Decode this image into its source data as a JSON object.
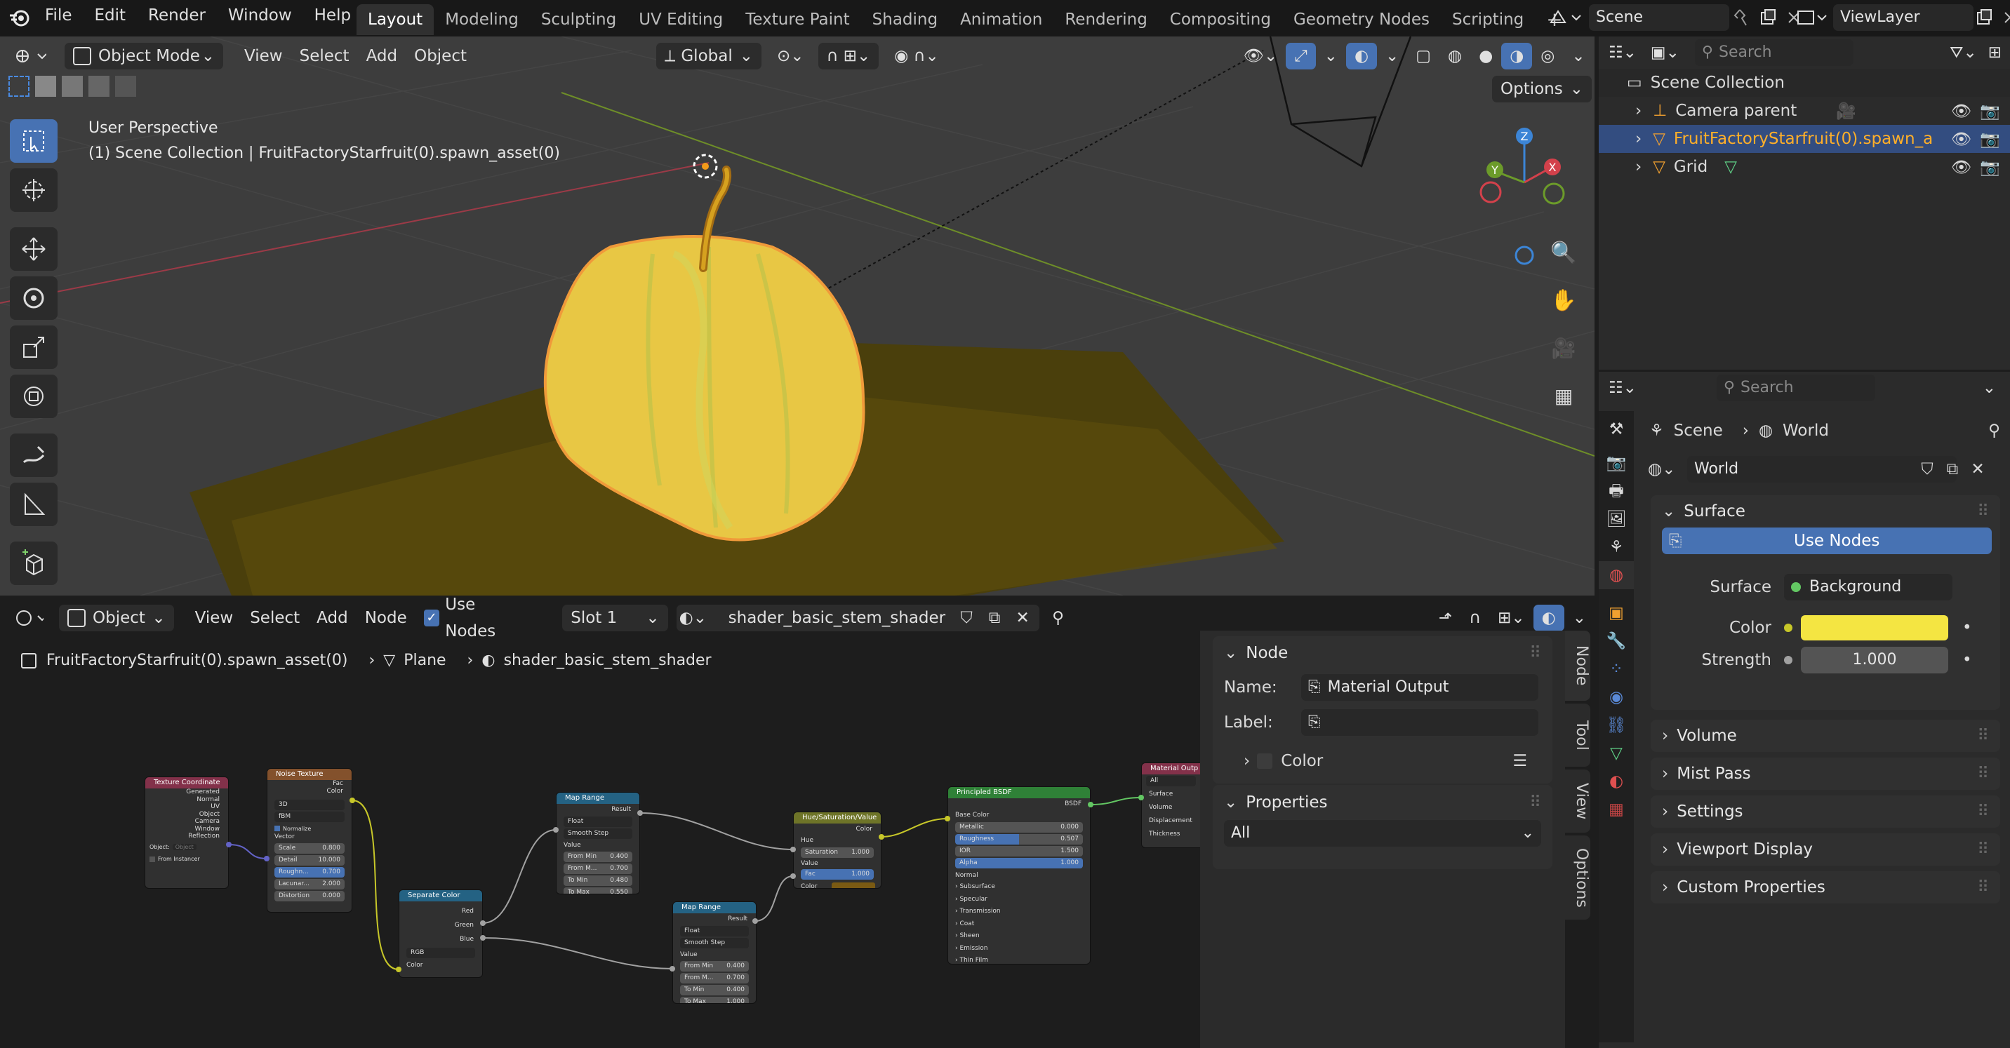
{
  "topbar": {
    "menus": [
      "File",
      "Edit",
      "Render",
      "Window",
      "Help"
    ],
    "workspaces": [
      "Layout",
      "Modeling",
      "Sculpting",
      "UV Editing",
      "Texture Paint",
      "Shading",
      "Animation",
      "Rendering",
      "Compositing",
      "Geometry Nodes",
      "Scripting"
    ],
    "active_workspace": "Layout",
    "scene": "Scene",
    "view_layer": "ViewLayer"
  },
  "viewport": {
    "mode": "Object Mode",
    "menus": [
      "View",
      "Select",
      "Add",
      "Object"
    ],
    "transform_orientation": "Global",
    "options_label": "Options",
    "overlay_title": "User Perspective",
    "overlay_subtitle": "(1) Scene Collection | FruitFactoryStarfruit(0).spawn_asset(0)",
    "gizmo": {
      "z": "Z",
      "y": "Y",
      "x": "X"
    }
  },
  "node_editor": {
    "mode": "Object",
    "menus": [
      "View",
      "Select",
      "Add",
      "Node"
    ],
    "use_nodes_label": "Use Nodes",
    "slot": "Slot 1",
    "material": "shader_basic_stem_shader",
    "breadcrumb": [
      "FruitFactoryStarfruit(0).spawn_asset(0)",
      "Plane",
      "shader_basic_stem_shader"
    ],
    "sidebar": {
      "node_panel": "Node",
      "name_label": "Name:",
      "name_value": "Material Output",
      "label_label": "Label:",
      "label_value": "",
      "color_label": "Color",
      "properties_panel": "Properties",
      "properties_value": "All",
      "tabs": [
        "Node",
        "Tool",
        "View",
        "Options"
      ]
    },
    "nodes": {
      "texcoord": {
        "title": "Texture Coordinate",
        "outputs": [
          "Generated",
          "Normal",
          "UV",
          "Object",
          "Camera",
          "Window",
          "Reflection"
        ],
        "object_label": "Object:",
        "object_ph": "Object",
        "from_instancer": "From Instancer"
      },
      "noise": {
        "title": "Noise Texture",
        "outputs": [
          "Fac",
          "Color"
        ],
        "dim": "3D",
        "type": "fBM",
        "normalize": "Normalize",
        "vector": "Vector",
        "fields": [
          [
            "Scale",
            "0.800"
          ],
          [
            "Detail",
            "10.000"
          ],
          [
            "Roughn...",
            "0.700"
          ],
          [
            "Lacunar...",
            "2.000"
          ],
          [
            "Distortion",
            "0.000"
          ]
        ]
      },
      "separate": {
        "title": "Separate Color",
        "outputs": [
          "Red",
          "Green",
          "Blue"
        ],
        "mode": "RGB",
        "input": "Color"
      },
      "maprange1": {
        "title": "Map Range",
        "output": "Result",
        "type": "Float",
        "interp": "Smooth Step",
        "value": "Value",
        "fields": [
          [
            "From Min",
            "0.400"
          ],
          [
            "From M...",
            "0.700"
          ],
          [
            "To Min",
            "0.480"
          ],
          [
            "To Max",
            "0.550"
          ]
        ]
      },
      "maprange2": {
        "title": "Map Range",
        "output": "Result",
        "type": "Float",
        "interp": "Smooth Step",
        "value": "Value",
        "fields": [
          [
            "From Min",
            "0.400"
          ],
          [
            "From M...",
            "0.700"
          ],
          [
            "To Min",
            "0.400"
          ],
          [
            "To Max",
            "1.000"
          ]
        ]
      },
      "hsv": {
        "title": "Hue/Saturation/Value",
        "output": "Color",
        "hue": "Hue",
        "sat": [
          "Saturation",
          "1.000"
        ],
        "value": "Value",
        "fac": [
          "Fac",
          "1.000"
        ],
        "color": "Color"
      },
      "bsdf": {
        "title": "Principled BSDF",
        "output": "BSDF",
        "base_color": "Base Color",
        "fields": [
          [
            "Metallic",
            "0.000"
          ],
          [
            "Roughness",
            "0.507"
          ],
          [
            "IOR",
            "1.500"
          ],
          [
            "Alpha",
            "1.000"
          ]
        ],
        "normal": "Normal",
        "subpanels": [
          "Subsurface",
          "Specular",
          "Transmission",
          "Coat",
          "Sheen",
          "Emission",
          "Thin Film"
        ]
      },
      "output": {
        "title": "Material Outp",
        "target": "All",
        "inputs": [
          "Surface",
          "Volume",
          "Displacement",
          "Thickness"
        ]
      }
    }
  },
  "outliner": {
    "search_placeholder": "Search",
    "root": "Scene Collection",
    "items": [
      "Camera parent",
      "FruitFactoryStarfruit(0).spawn_a",
      "Grid"
    ]
  },
  "properties": {
    "search_placeholder": "Search",
    "breadcrumb": [
      "Scene",
      "World"
    ],
    "world_name": "World",
    "surface_panel": "Surface",
    "use_nodes_button": "Use Nodes",
    "surface_label": "Surface",
    "surface_value": "Background",
    "color_label": "Color",
    "color_value": "#f4e542",
    "strength_label": "Strength",
    "strength_value": "1.000",
    "collapsed_panels": [
      "Volume",
      "Mist Pass",
      "Settings",
      "Viewport Display",
      "Custom Properties"
    ]
  }
}
